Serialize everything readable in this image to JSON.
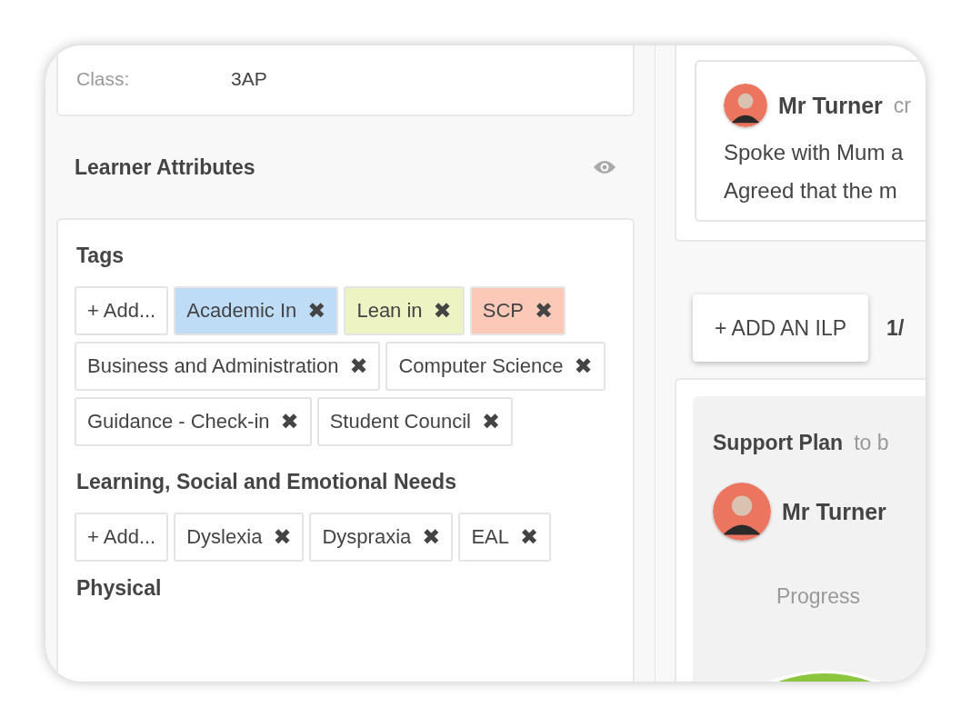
{
  "class_info": {
    "label": "Class:",
    "value": "3AP"
  },
  "learner_attributes": {
    "title": "Learner Attributes",
    "sections": [
      {
        "title": "Tags",
        "add_label": "+ Add...",
        "remove_symbol": "✖",
        "items": [
          {
            "label": "Academic In",
            "color": "#bfdcf7"
          },
          {
            "label": "Lean in",
            "color": "#eef3c4"
          },
          {
            "label": "SCP",
            "color": "#fcc9b9"
          },
          {
            "label": "Business and Administration",
            "color": "#ffffff"
          },
          {
            "label": "Computer Science",
            "color": "#ffffff"
          },
          {
            "label": "Guidance - Check-in",
            "color": "#ffffff"
          },
          {
            "label": "Student Council",
            "color": "#ffffff"
          }
        ]
      },
      {
        "title": "Learning, Social and Emotional Needs",
        "add_label": "+ Add...",
        "remove_symbol": "✖",
        "items": [
          {
            "label": "Dyslexia",
            "color": "#ffffff"
          },
          {
            "label": "Dyspraxia",
            "color": "#ffffff"
          },
          {
            "label": "EAL",
            "color": "#ffffff"
          }
        ]
      }
    ],
    "next_section_title": "Physical"
  },
  "note": {
    "author": "Mr Turner",
    "action": "cr",
    "lines": [
      "Spoke with Mum a",
      "Agreed that the m"
    ]
  },
  "ilp": {
    "add_button": "+ ADD AN ILP",
    "counter": "1/"
  },
  "support_plan": {
    "title": "Support Plan",
    "subtitle": "to b",
    "author": "Mr Turner",
    "progress_label": "Progress"
  }
}
